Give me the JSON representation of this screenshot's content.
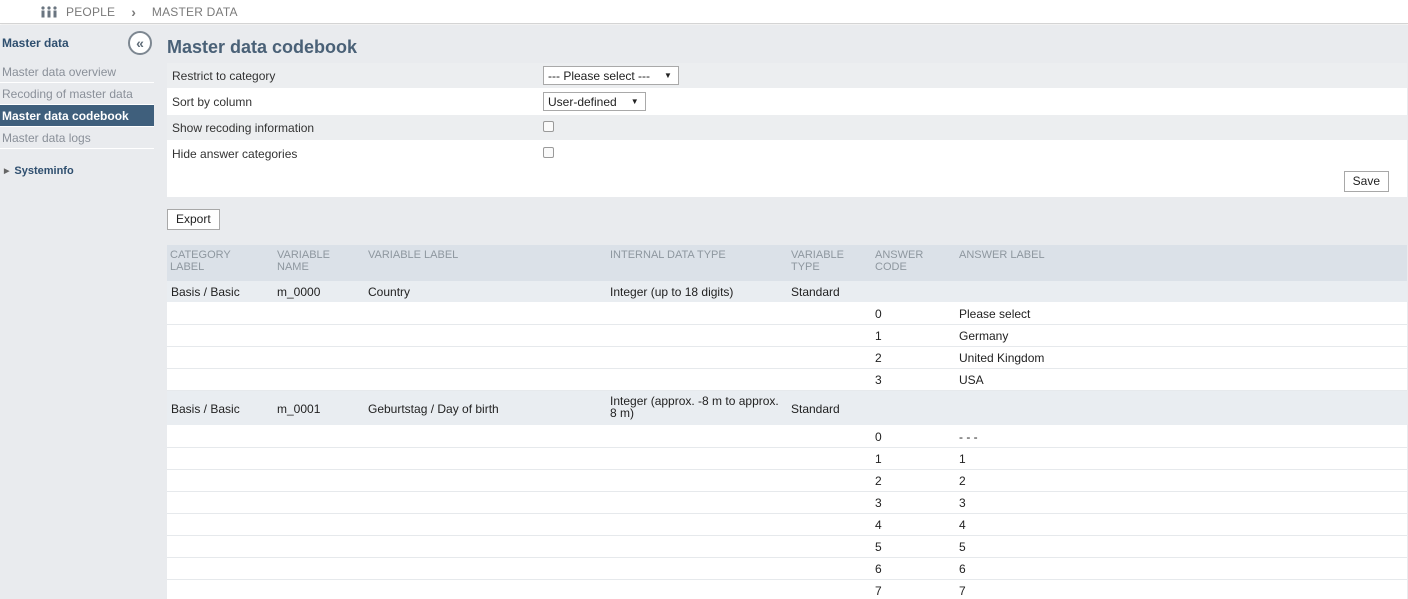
{
  "breadcrumb": {
    "root": "PEOPLE",
    "current": "MASTER DATA"
  },
  "sidebar": {
    "title": "Master data",
    "collapse_symbol": "«",
    "items": [
      {
        "label": "Master data overview",
        "active": false
      },
      {
        "label": "Recoding of master data",
        "active": false
      },
      {
        "label": "Master data codebook",
        "active": true
      },
      {
        "label": "Master data logs",
        "active": false
      }
    ],
    "section": "Systeminfo"
  },
  "page": {
    "title": "Master data codebook"
  },
  "form": {
    "restrict_label": "Restrict to category",
    "restrict_value": "--- Please select ---",
    "sort_label": "Sort by column",
    "sort_value": "User-defined",
    "recoding_label": "Show recoding information",
    "recoding_checked": false,
    "hide_label": "Hide answer categories",
    "hide_checked": false,
    "save_label": "Save"
  },
  "export_label": "Export",
  "table": {
    "headers": {
      "category_label": "CATEGORY LABEL",
      "variable_name": "VARIABLE NAME",
      "variable_label": "VARIABLE LABEL",
      "internal_data_type": "INTERNAL DATA TYPE",
      "variable_type": "VARIABLE TYPE",
      "answer_code": "ANSWER CODE",
      "answer_label": "ANSWER LABEL"
    },
    "variables": [
      {
        "category": "Basis / Basic",
        "name": "m_0000",
        "label": "Country",
        "data_type": "Integer (up to 18 digits)",
        "type": "Standard",
        "answers": [
          {
            "code": "0",
            "label": "Please select"
          },
          {
            "code": "1",
            "label": "Germany"
          },
          {
            "code": "2",
            "label": "United Kingdom"
          },
          {
            "code": "3",
            "label": "USA"
          }
        ]
      },
      {
        "category": "Basis / Basic",
        "name": "m_0001",
        "label": "Geburtstag / Day of birth",
        "data_type": "Integer (approx. -8 m to approx. 8 m)",
        "type": "Standard",
        "answers": [
          {
            "code": "0",
            "label": "- - -"
          },
          {
            "code": "1",
            "label": "1"
          },
          {
            "code": "2",
            "label": "2"
          },
          {
            "code": "3",
            "label": "3"
          },
          {
            "code": "4",
            "label": "4"
          },
          {
            "code": "5",
            "label": "5"
          },
          {
            "code": "6",
            "label": "6"
          },
          {
            "code": "7",
            "label": "7"
          }
        ]
      }
    ]
  }
}
